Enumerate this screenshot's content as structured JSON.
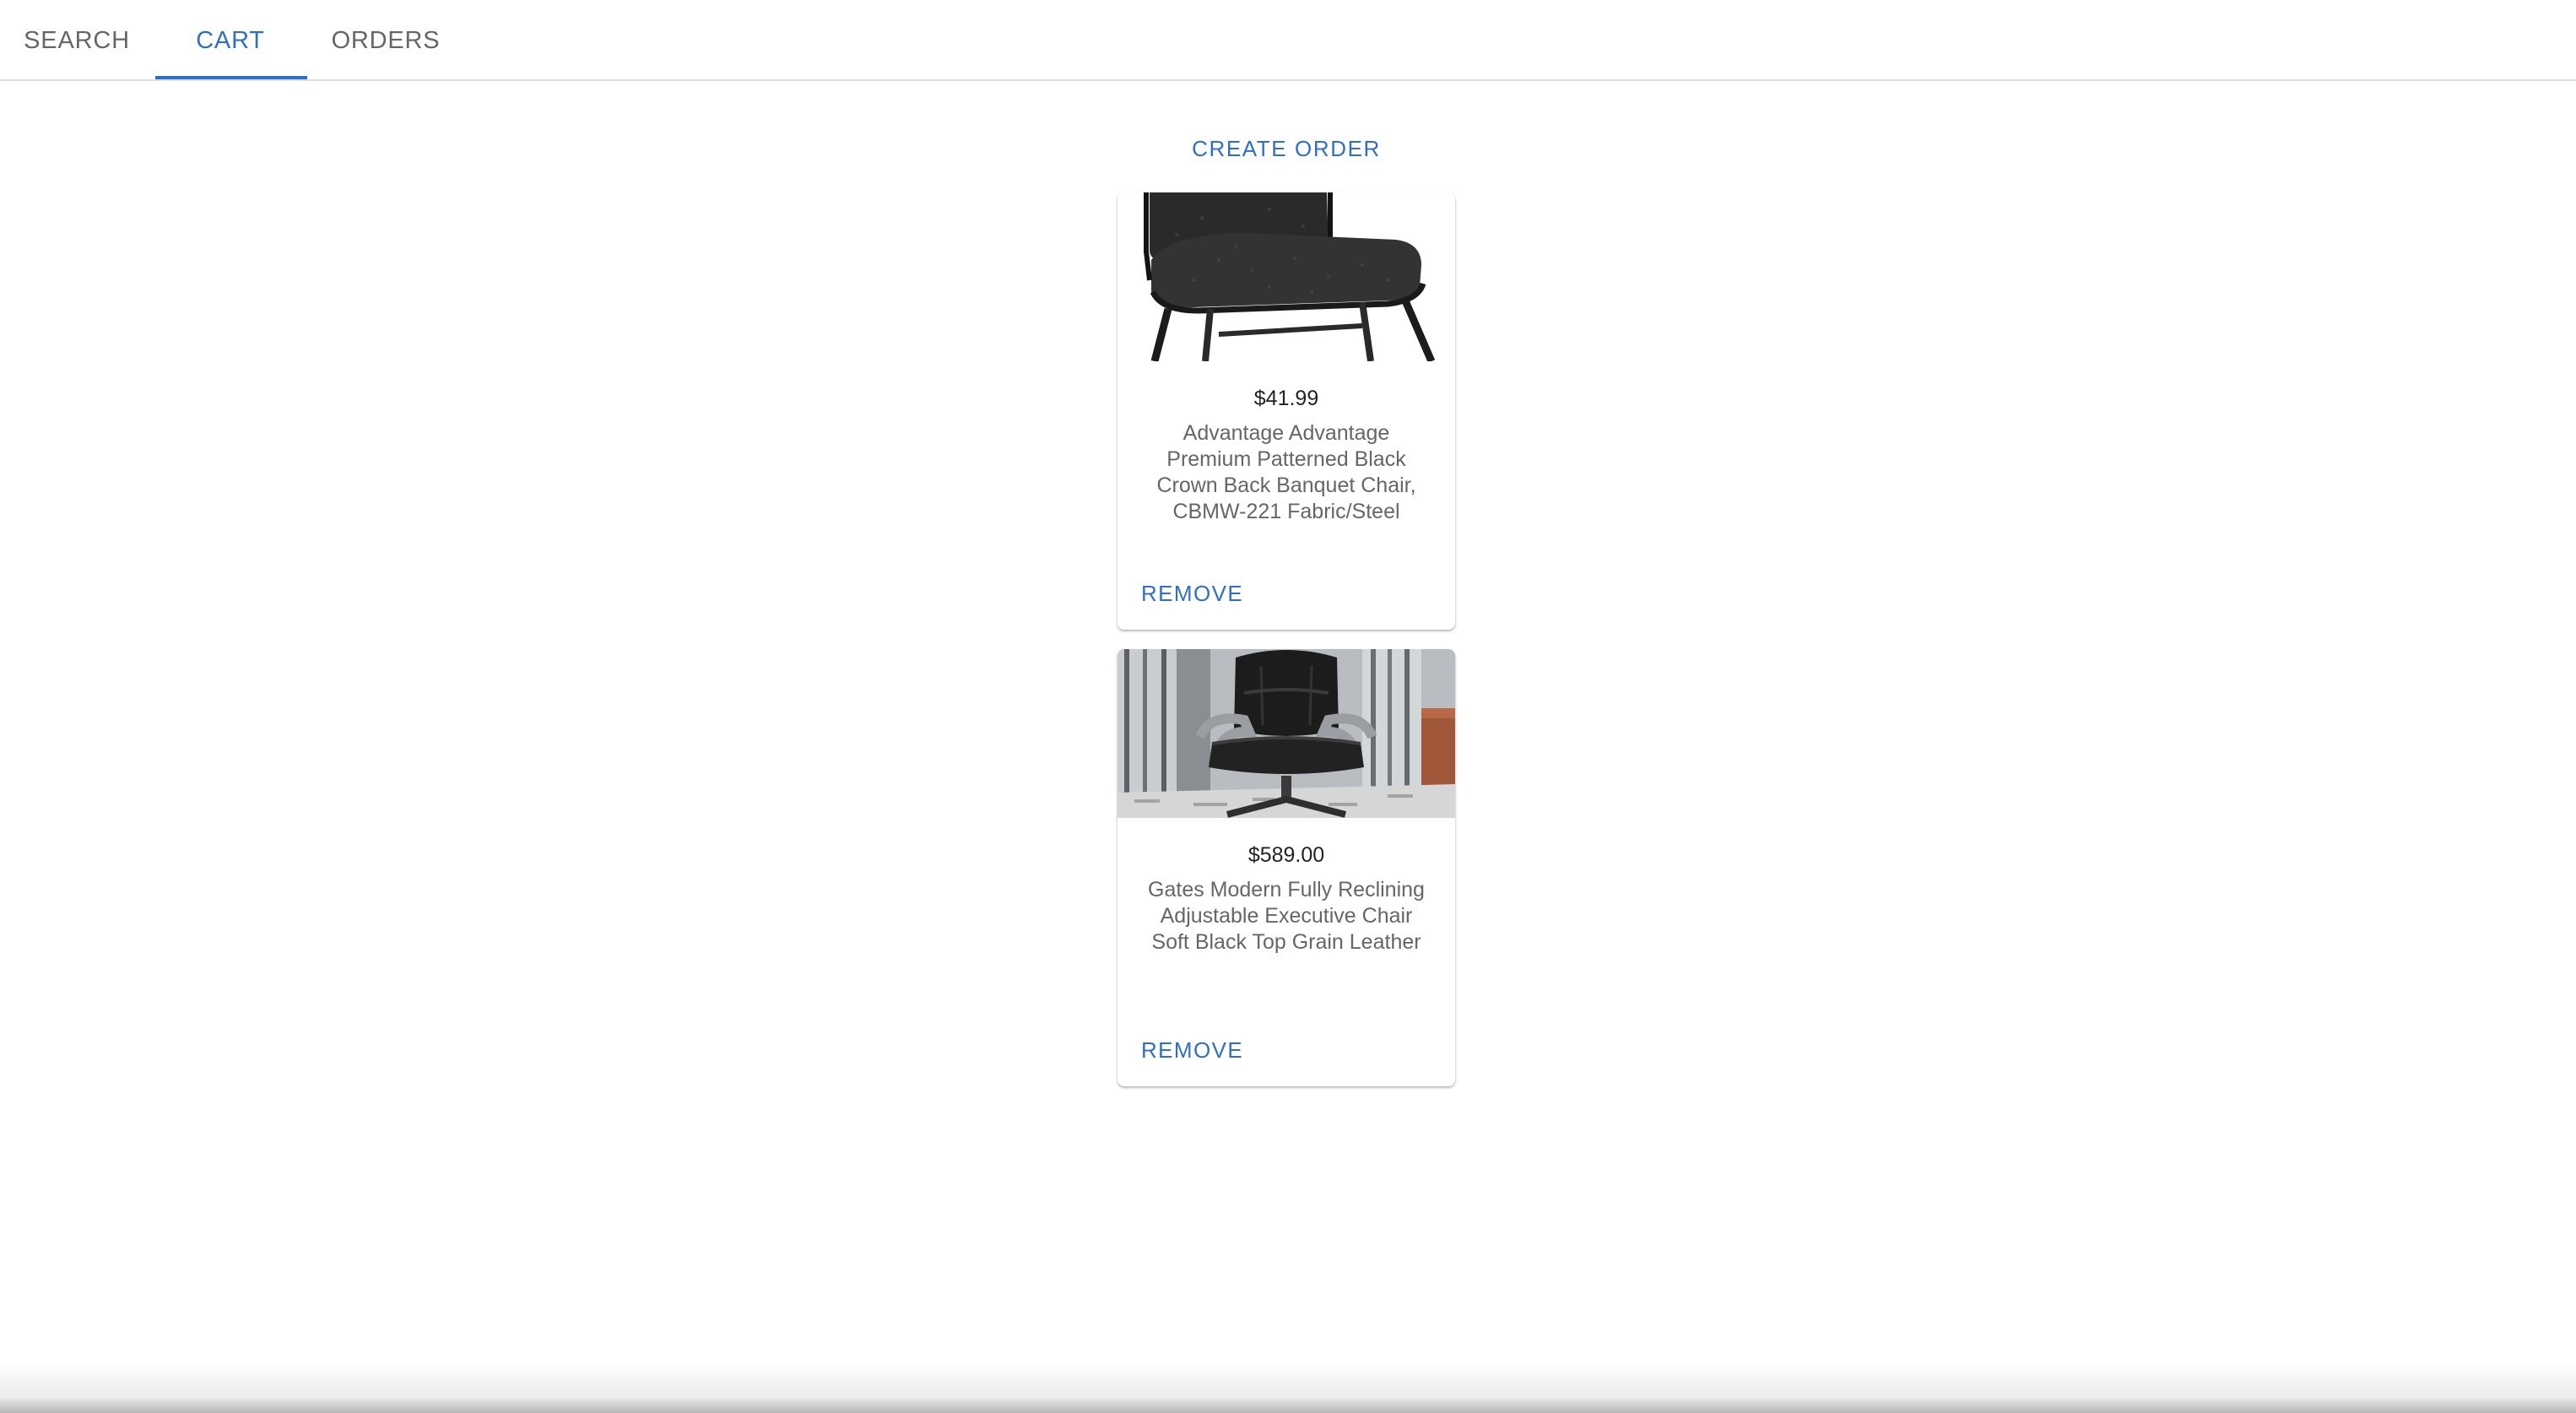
{
  "tabs": [
    {
      "label": "SEARCH",
      "active": false
    },
    {
      "label": "CART",
      "active": true
    },
    {
      "label": "ORDERS",
      "active": false
    }
  ],
  "colors": {
    "accent": "#2f6fc9",
    "tab_inactive": "#666666",
    "price": "#222222",
    "description": "#666666"
  },
  "cart": {
    "create_order_label": "CREATE ORDER",
    "items": [
      {
        "image_icon": "banquet-chair-image",
        "price": "$41.99",
        "title": "Advantage Advantage Premium Patterned Black Crown Back Banquet Chair, CBMW-221 Fabric/Steel",
        "remove_label": "REMOVE"
      },
      {
        "image_icon": "executive-chair-image",
        "price": "$589.00",
        "title": "Gates Modern Fully Reclining Adjustable Executive Chair Soft Black Top Grain Leather",
        "remove_label": "REMOVE"
      }
    ]
  }
}
